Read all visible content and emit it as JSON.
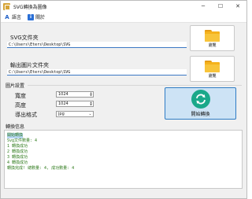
{
  "window": {
    "title": "SVG轉換為圖像",
    "controls": {
      "minimize": "─",
      "maximize": "☐",
      "close": "✕"
    }
  },
  "menu": {
    "items": [
      {
        "label": "語言",
        "icon": "language-icon"
      },
      {
        "label": "關於",
        "icon": "info-icon"
      }
    ]
  },
  "svg_folder": {
    "label": "SVG文件夾",
    "value": "C:\\Users\\Eters\\Desktop\\SVG",
    "browse_label": "瀏覽"
  },
  "output_folder": {
    "label": "輸出圖片文件夾",
    "value": "C:\\Users\\Eters\\Desktop\\SVG",
    "browse_label": "瀏覽"
  },
  "image_settings": {
    "title": "圖片設置",
    "width_label": "寬度",
    "width_value": "1024",
    "height_label": "高度",
    "height_value": "1024",
    "format_label": "導出格式",
    "format_value": "jpg"
  },
  "start_button": {
    "label": "開始轉換"
  },
  "log": {
    "title": "轉換信息",
    "lines": [
      "開始轉換",
      "Svg文件數量: 4",
      "1 轉換成功",
      "2 轉換成功",
      "3 轉換成功",
      "4 轉換成功",
      "轉換完成! 總數量: 4, 成功數量: 4"
    ]
  },
  "colors": {
    "accent": "#2f7cc4",
    "start_button_bg": "#cde3f5",
    "refresh_icon": "#1aa88a",
    "log_text": "#2d7a1a",
    "folder": "#f5b21c"
  }
}
